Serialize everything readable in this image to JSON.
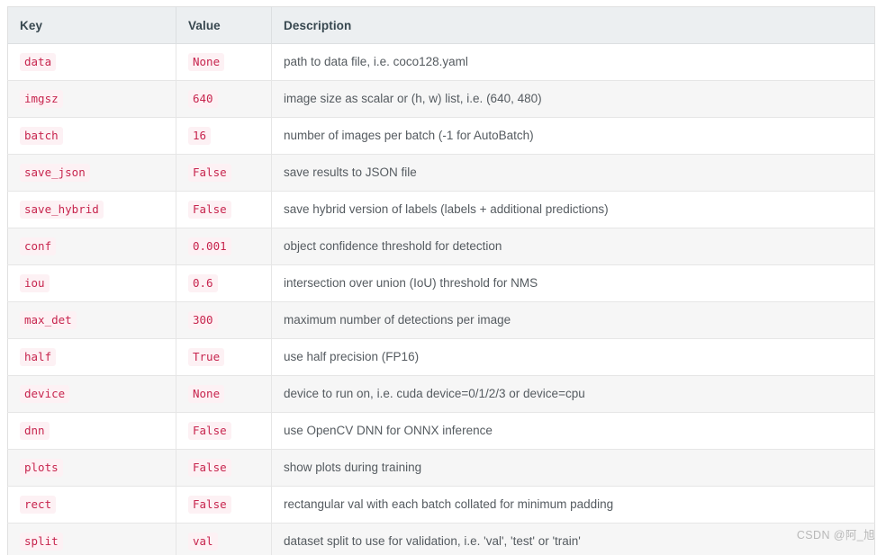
{
  "table": {
    "columns": [
      "Key",
      "Value",
      "Description"
    ],
    "rows": [
      {
        "key": "data",
        "value": "None",
        "description": "path to data file, i.e. coco128.yaml"
      },
      {
        "key": "imgsz",
        "value": "640",
        "description": "image size as scalar or (h, w) list, i.e. (640, 480)"
      },
      {
        "key": "batch",
        "value": "16",
        "description": "number of images per batch (-1 for AutoBatch)"
      },
      {
        "key": "save_json",
        "value": "False",
        "description": "save results to JSON file"
      },
      {
        "key": "save_hybrid",
        "value": "False",
        "description": "save hybrid version of labels (labels + additional predictions)"
      },
      {
        "key": "conf",
        "value": "0.001",
        "description": "object confidence threshold for detection"
      },
      {
        "key": "iou",
        "value": "0.6",
        "description": "intersection over union (IoU) threshold for NMS"
      },
      {
        "key": "max_det",
        "value": "300",
        "description": "maximum number of detections per image"
      },
      {
        "key": "half",
        "value": "True",
        "description": "use half precision (FP16)"
      },
      {
        "key": "device",
        "value": "None",
        "description": "device to run on, i.e. cuda device=0/1/2/3 or device=cpu"
      },
      {
        "key": "dnn",
        "value": "False",
        "description": "use OpenCV DNN for ONNX inference"
      },
      {
        "key": "plots",
        "value": "False",
        "description": "show plots during training"
      },
      {
        "key": "rect",
        "value": "False",
        "description": "rectangular val with each batch collated for minimum padding"
      },
      {
        "key": "split",
        "value": "val",
        "description": "dataset split to use for validation, i.e. 'val', 'test' or 'train'"
      }
    ]
  },
  "watermark": {
    "text": "CSDN @阿_旭"
  },
  "colors": {
    "header_bg": "#eceff1",
    "header_text": "#37474f",
    "row_even_bg": "#f6f6f6",
    "row_odd_bg": "#ffffff",
    "code_text": "#c7254e",
    "code_bg": "#fdf1f4",
    "desc_text": "#555b60",
    "border": "#e6e6e6",
    "watermark_text": "#b8b8b8"
  }
}
